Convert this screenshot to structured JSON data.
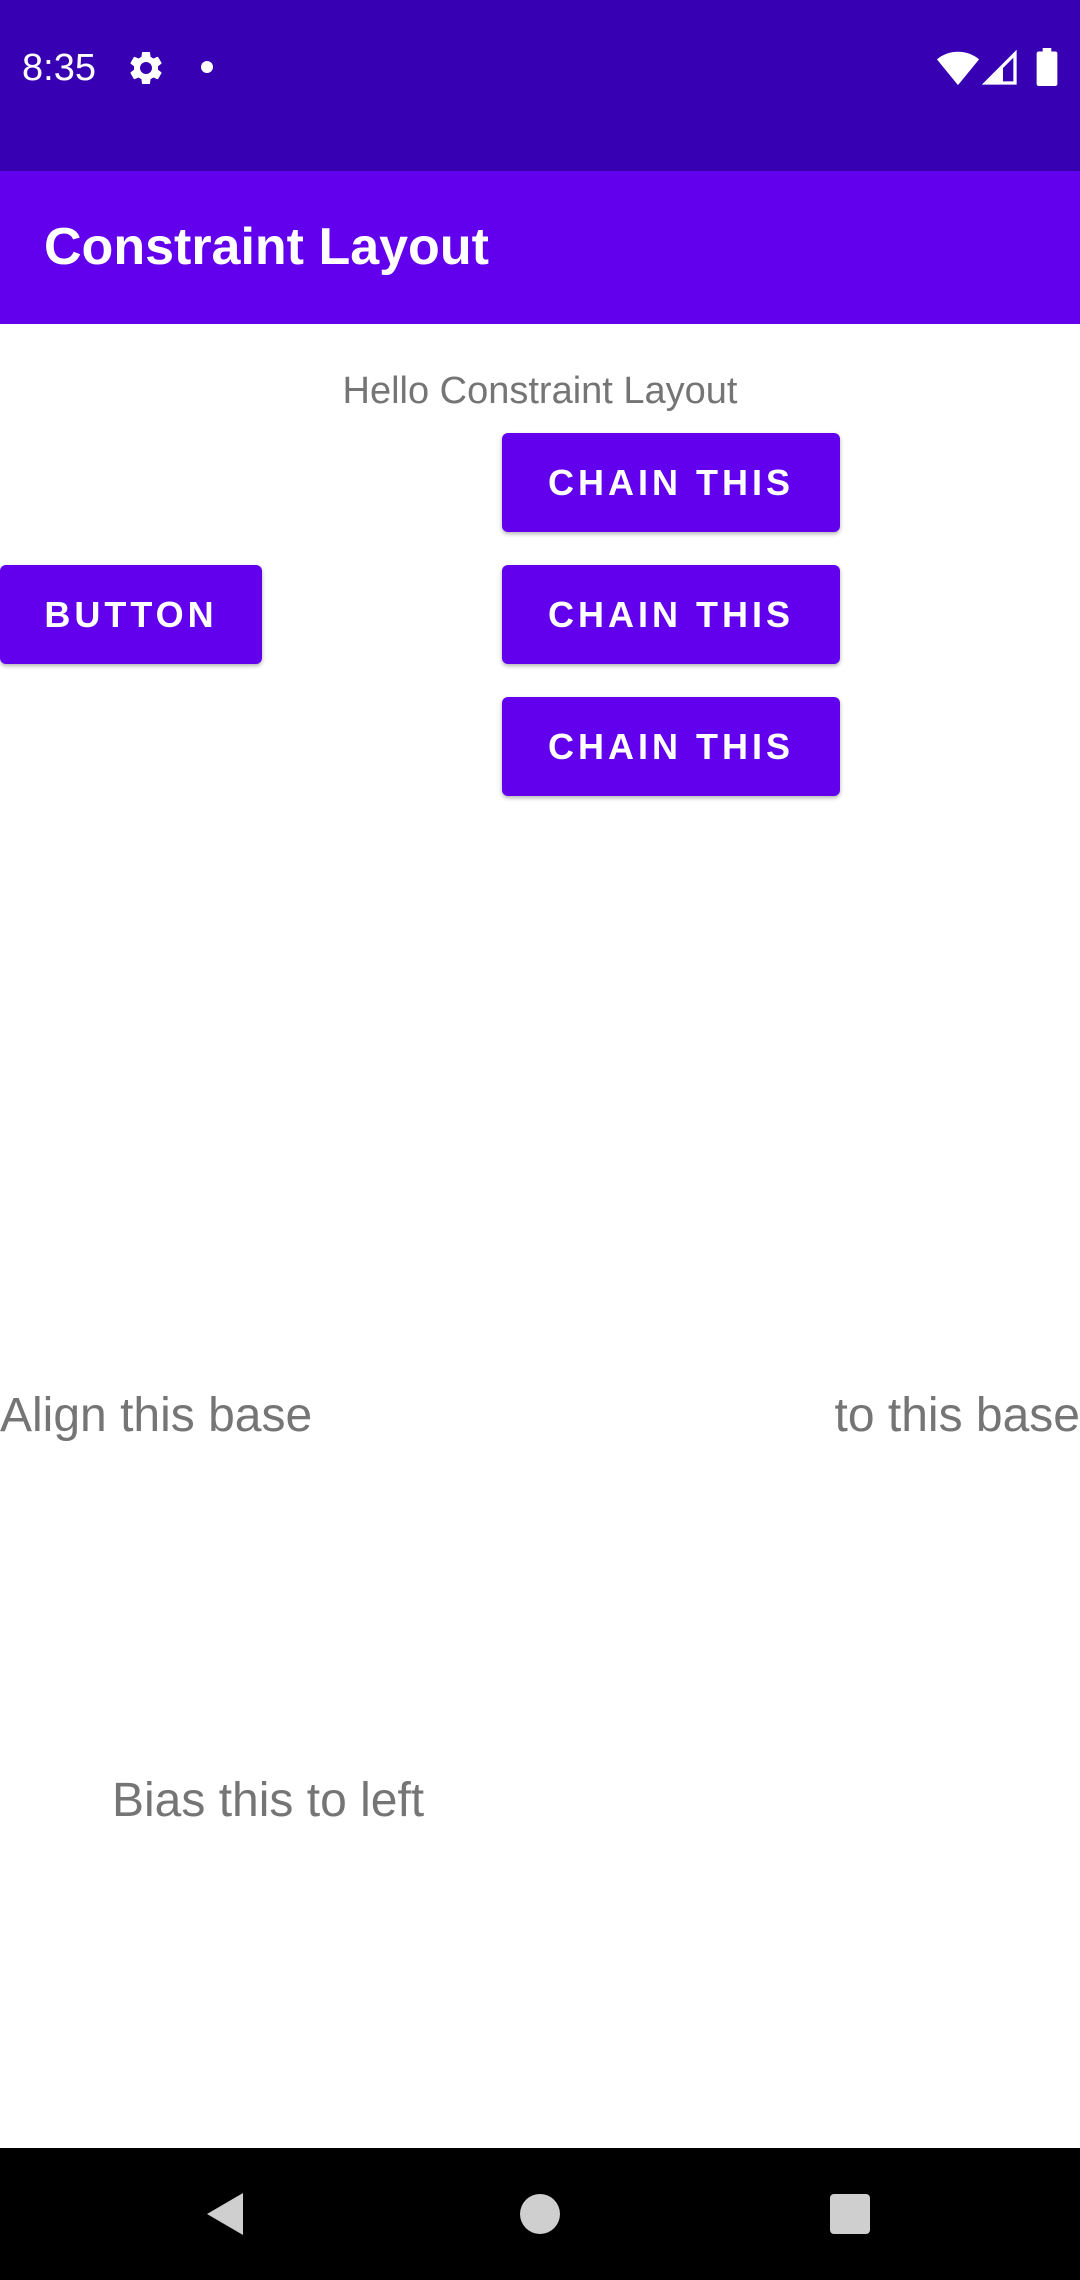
{
  "status_bar": {
    "time": "8:35",
    "background": "#3700B3",
    "icons": [
      "gear-icon",
      "notification-dot-icon",
      "wifi-icon",
      "signal-icon",
      "battery-icon"
    ]
  },
  "app_bar": {
    "title": "Constraint Layout",
    "background": "#6200EE"
  },
  "content": {
    "hello_text": "Hello Constraint Layout",
    "chain_buttons": [
      {
        "label": "CHAIN THIS"
      },
      {
        "label": "CHAIN THIS"
      },
      {
        "label": "CHAIN THIS"
      }
    ],
    "button_label": "BUTTON",
    "align_left_text": "Align this base",
    "align_right_text": "to this base",
    "bias_text": "Bias this to left"
  },
  "colors": {
    "primary": "#6200EE",
    "primary_dark": "#3700B3",
    "text_secondary": "#757575"
  },
  "nav_bar": {
    "icons": [
      "back-icon",
      "home-icon",
      "recents-icon"
    ]
  }
}
